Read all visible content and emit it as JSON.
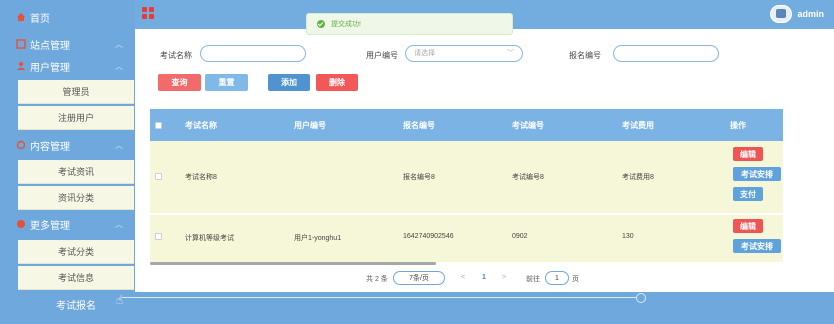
{
  "sidebar": {
    "items": [
      {
        "label": "首页",
        "icon": "home-icon"
      },
      {
        "label": "站点管理",
        "icon": "site-icon"
      },
      {
        "label": "用户管理",
        "icon": "user-icon"
      },
      {
        "label": "内容管理",
        "icon": "content-icon"
      },
      {
        "label": "更多管理",
        "icon": "more-icon"
      }
    ],
    "subitems": [
      "管理员",
      "注册用户",
      "考试资讯",
      "资讯分类",
      "考试分类",
      "考试信息",
      "考试报名"
    ]
  },
  "header": {
    "user": "admin"
  },
  "toast": {
    "message": "提交成功!"
  },
  "search": {
    "name_label": "考试名称",
    "user_label": "用户编号",
    "user_placeholder": "请选择",
    "signup_label": "报名编号",
    "query": "查询",
    "reset": "重置",
    "add": "添加",
    "delete": "删除"
  },
  "table": {
    "columns": [
      "考试名称",
      "用户编号",
      "报名编号",
      "考试编号",
      "考试费用",
      "操作"
    ],
    "rows": [
      {
        "name": "考试名称8",
        "user": "",
        "signup": "报名编号8",
        "exam": "考试编号8",
        "fee": "考试费用8",
        "actions": [
          "编辑",
          "考试安排",
          "支付"
        ]
      },
      {
        "name": "计算机等级考试",
        "user": "用户1-yonghu1",
        "signup": "1642740902546",
        "exam": "0902",
        "fee": "130",
        "actions": [
          "编辑",
          "考试安排"
        ]
      }
    ]
  },
  "pagination": {
    "total": "共 2 条",
    "page_size": "7条/页",
    "prev": "<",
    "page": "1",
    "next": ">",
    "goto_label": "前往",
    "goto_page": "1",
    "goto_suffix": "页"
  },
  "colors": {
    "primary": "#6fa8dc",
    "danger": "#f36a6a",
    "row_bg": "#f6f7d9"
  }
}
